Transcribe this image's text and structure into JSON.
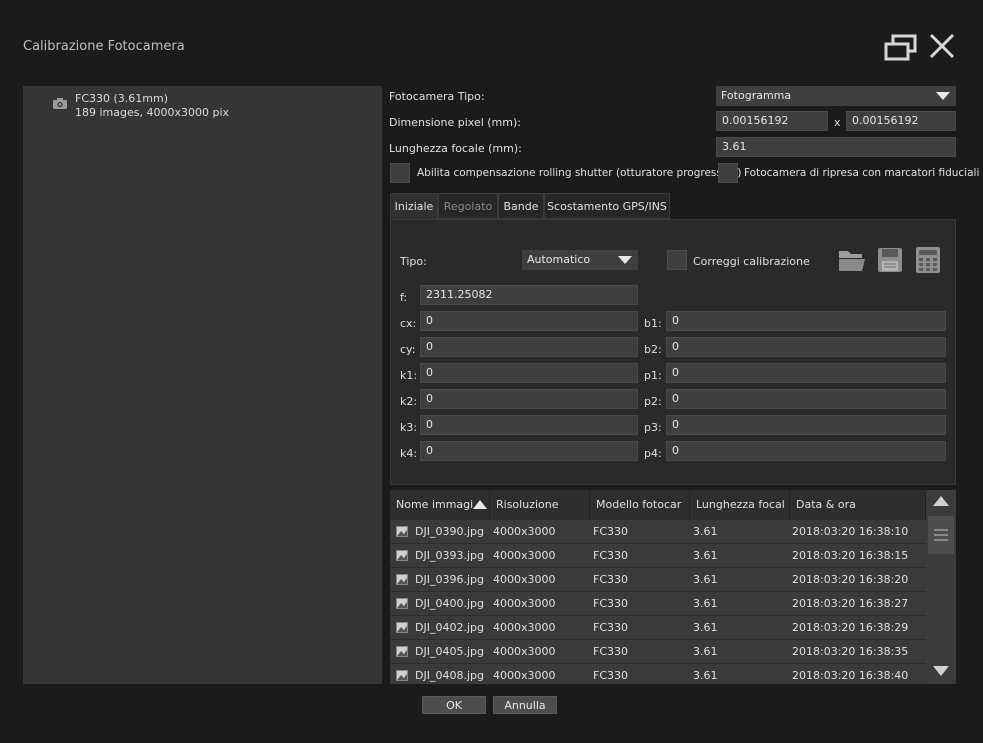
{
  "window": {
    "title": "Calibrazione Fotocamera"
  },
  "camera_list": [
    {
      "name": "FC330 (3.61mm)",
      "info": "189 images, 4000x3000 pix"
    }
  ],
  "camera_props": {
    "type_label": "Fotocamera Tipo:",
    "type_value": "Fotogramma",
    "pixel_label": "Dimensione pixel (mm):",
    "pixel_x": "0.00156192",
    "pixel_sep": "x",
    "pixel_y": "0.00156192",
    "focal_label": "Lunghezza focale (mm):",
    "focal_value": "3.61",
    "rolling_shutter_label": "Abilita compensazione rolling shutter (otturatore progressivo)",
    "fiducial_label": "Fotocamera di ripresa con marcatori fiduciali"
  },
  "tabs": [
    "Iniziale",
    "Regolato",
    "Bande",
    "Scostamento GPS/INS"
  ],
  "calibration": {
    "tipo_label": "Tipo:",
    "tipo_value": "Automatico",
    "correct_label": "Correggi calibrazione",
    "f_label": "f:",
    "f_value": "2311.25082",
    "left_params": [
      {
        "label": "cx:",
        "value": "0"
      },
      {
        "label": "cy:",
        "value": "0"
      },
      {
        "label": "k1:",
        "value": "0"
      },
      {
        "label": "k2:",
        "value": "0"
      },
      {
        "label": "k3:",
        "value": "0"
      },
      {
        "label": "k4:",
        "value": "0"
      }
    ],
    "right_params": [
      {
        "label": "b1:",
        "value": "0"
      },
      {
        "label": "b2:",
        "value": "0"
      },
      {
        "label": "p1:",
        "value": "0"
      },
      {
        "label": "p2:",
        "value": "0"
      },
      {
        "label": "p3:",
        "value": "0"
      },
      {
        "label": "p4:",
        "value": "0"
      }
    ]
  },
  "table": {
    "columns": [
      "Nome immagi",
      "Risoluzione",
      "Modello fotocar",
      "Lunghezza focal",
      "Data & ora"
    ],
    "rows": [
      [
        "DJI_0390.jpg",
        "4000x3000",
        "FC330",
        "3.61",
        "2018:03:20 16:38:10"
      ],
      [
        "DJI_0393.jpg",
        "4000x3000",
        "FC330",
        "3.61",
        "2018:03:20 16:38:15"
      ],
      [
        "DJI_0396.jpg",
        "4000x3000",
        "FC330",
        "3.61",
        "2018:03:20 16:38:20"
      ],
      [
        "DJI_0400.jpg",
        "4000x3000",
        "FC330",
        "3.61",
        "2018:03:20 16:38:27"
      ],
      [
        "DJI_0402.jpg",
        "4000x3000",
        "FC330",
        "3.61",
        "2018:03:20 16:38:29"
      ],
      [
        "DJI_0405.jpg",
        "4000x3000",
        "FC330",
        "3.61",
        "2018:03:20 16:38:35"
      ],
      [
        "DJI_0408.jpg",
        "4000x3000",
        "FC330",
        "3.61",
        "2018:03:20 16:38:40"
      ]
    ]
  },
  "buttons": {
    "ok": "OK",
    "cancel": "Annulla"
  }
}
